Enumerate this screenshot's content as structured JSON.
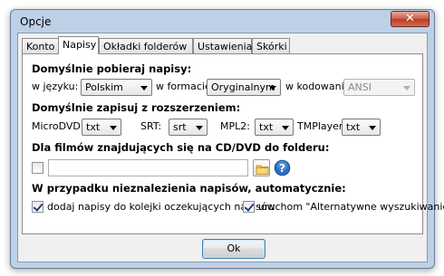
{
  "window": {
    "title": "Opcje",
    "close_glyph": "✕"
  },
  "tabs": [
    {
      "label": "Konto",
      "active": false
    },
    {
      "label": "Napisy",
      "active": true
    },
    {
      "label": "Okładki folderów",
      "active": false
    },
    {
      "label": "Ustawienia",
      "active": false
    },
    {
      "label": "Skórki",
      "active": false
    }
  ],
  "download": {
    "heading": "Domyślnie pobieraj napisy:",
    "language_label": "w języku:",
    "language_value": "Polskim",
    "format_label": "w formacie:",
    "format_value": "Oryginalnym",
    "encoding_label": "w kodowaniu:",
    "encoding_value": "ANSI",
    "encoding_disabled": true
  },
  "save": {
    "heading": "Domyślnie zapisuj z rozszerzeniem:",
    "microdvd_label": "MicroDVD:",
    "microdvd_value": "txt",
    "srt_label": "SRT:",
    "srt_value": "srt",
    "mpl2_label": "MPL2:",
    "mpl2_value": "txt",
    "tmplayer_label": "TMPlayer:",
    "tmplayer_value": "txt"
  },
  "cd_dvd": {
    "heading": "Dla filmów znajdujących się na CD/DVD do folderu:",
    "enabled": false,
    "path_value": "",
    "folder_icon": "folder-icon",
    "help_icon": "help-icon"
  },
  "not_found": {
    "heading": "W przypadku nieznalezienia napisów, automatycznie:",
    "queue_label": "dodaj napisy do kolejki oczekujących napisów",
    "queue_checked": true,
    "alt_search_label": "uruchom \"Alternatywne wyszukiwanie\"",
    "alt_search_checked": true
  },
  "ok_label": "Ok"
}
